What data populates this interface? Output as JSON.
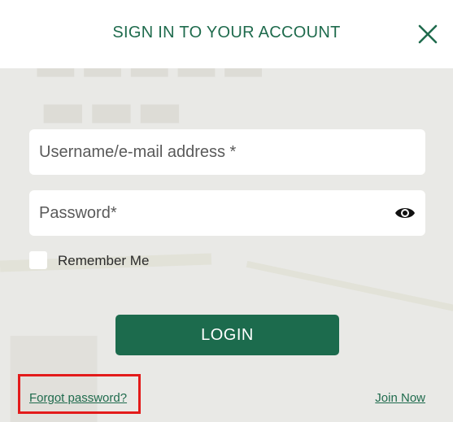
{
  "dialog": {
    "title": "SIGN IN TO YOUR ACCOUNT",
    "close_icon": "close-icon"
  },
  "form": {
    "username_placeholder": "Username/e-mail address *",
    "username_value": "",
    "password_placeholder": "Password*",
    "password_value": "",
    "password_toggle_icon": "eye-icon",
    "remember_label": "Remember Me",
    "remember_checked": false,
    "login_label": "LOGIN"
  },
  "links": {
    "forgot_password": "Forgot password?",
    "join_now": "Join Now"
  },
  "colors": {
    "brand_green": "#1c6b4d",
    "highlight_red": "#e31b1b"
  }
}
